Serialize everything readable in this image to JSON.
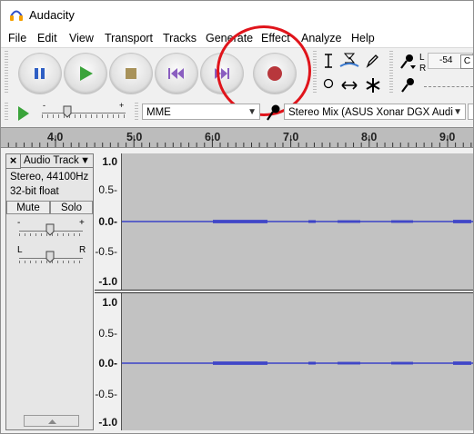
{
  "window": {
    "title": "Audacity"
  },
  "menu": [
    "File",
    "Edit",
    "View",
    "Transport",
    "Tracks",
    "Generate",
    "Effect",
    "Analyze",
    "Help"
  ],
  "transport": {
    "pause": "pause-icon",
    "play": "play-icon",
    "stop": "stop-icon",
    "skip_start": "skip-to-start-icon",
    "skip_end": "skip-to-end-icon",
    "record": "record-icon"
  },
  "tools": [
    "selection-tool",
    "envelope-tool",
    "draw-tool",
    "zoom-tool",
    "time-shift-tool",
    "multi-tool"
  ],
  "meters": {
    "record_ticks": "-54",
    "lr_left": "L",
    "lr_right": "R",
    "partial_text": "C"
  },
  "device": {
    "host": "MME",
    "recording_device": "Stereo Mix (ASUS Xonar DGX Audi"
  },
  "ruler": {
    "labels": [
      "4.0",
      "5.0",
      "6.0",
      "7.0",
      "8.0",
      "9.0"
    ]
  },
  "track": {
    "name": "Audio Track",
    "info_line1": "Stereo, 44100Hz",
    "info_line2": "32-bit float",
    "mute": "Mute",
    "solo": "Solo",
    "gain_minus": "-",
    "gain_plus": "+",
    "pan_left": "L",
    "pan_right": "R"
  },
  "vruler": {
    "ch1": [
      "1.0",
      "0.5-",
      "0.0-",
      "-0.5-",
      "-1.0"
    ],
    "ch2": [
      "1.0",
      "0.5-",
      "0.0-",
      "-0.5-",
      "-1.0"
    ]
  },
  "colors": {
    "waveform": "#3b42c8",
    "highlight": "#e0141b",
    "play": "#3aa33a"
  }
}
